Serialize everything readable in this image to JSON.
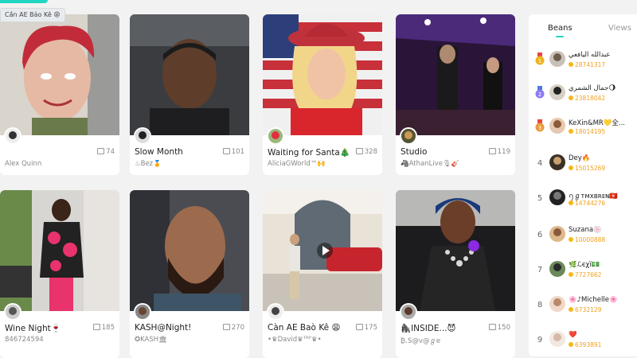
{
  "tooltip": "Cần AE Bảo Kê 😩",
  "streams": [
    {
      "title": "",
      "creator": "Alex Quinn",
      "viewers": "74"
    },
    {
      "title": "Slow Month",
      "creator": "♨Bez🏅",
      "viewers": "101"
    },
    {
      "title": "Waiting for Santa🎄",
      "creator": "AliciaGWorld™🙌",
      "viewers": "328"
    },
    {
      "title": "Studio",
      "creator": "🦓AthanLive🎙🎸",
      "viewers": "119"
    },
    {
      "title": "Wine Night🍷",
      "creator": "846724594",
      "viewers": "185"
    },
    {
      "title": "KASH@Night!",
      "creator": "✪KASH🏛",
      "viewers": "270"
    },
    {
      "title": "Càn AE Baò Kê 😩",
      "creator": "•♛David♛ᵀᴿᴾ♛•",
      "viewers": "175"
    },
    {
      "title": "🦍INSIDE...😈",
      "creator": "₿.S@v@ℊe",
      "viewers": "150"
    }
  ],
  "leaderboard": {
    "tabs": {
      "active": "Beans",
      "inactive": "Views"
    },
    "rows": [
      {
        "rank": "1",
        "name": "عبدالله اليافعي",
        "beans": "28741317",
        "medal": "#f0b21c"
      },
      {
        "rank": "2",
        "name": "جمال الشمري🌖",
        "beans": "23818042",
        "medal": "#8a7cf2"
      },
      {
        "rank": "3",
        "name": "KeXin&MR💛全...",
        "beans": "18014195",
        "medal": "#e89a3a"
      },
      {
        "rank": "4",
        "name": "Dey🔥",
        "beans": "15015269",
        "medal": ""
      },
      {
        "rank": "5",
        "name": "ꪆℊтᴍxʙʀᴇɴ🇭🇰",
        "beans": "14744276",
        "medal": ""
      },
      {
        "rank": "6",
        "name": "Suzana🍥",
        "beans": "10000888",
        "medal": ""
      },
      {
        "rank": "7",
        "name": "🌿ℒєχї💵",
        "beans": "7727662",
        "medal": ""
      },
      {
        "rank": "8",
        "name": "🌸♪Michelle🌸",
        "beans": "6732129",
        "medal": ""
      },
      {
        "rank": "9",
        "name": "❤️",
        "beans": "6393891",
        "medal": ""
      }
    ]
  }
}
